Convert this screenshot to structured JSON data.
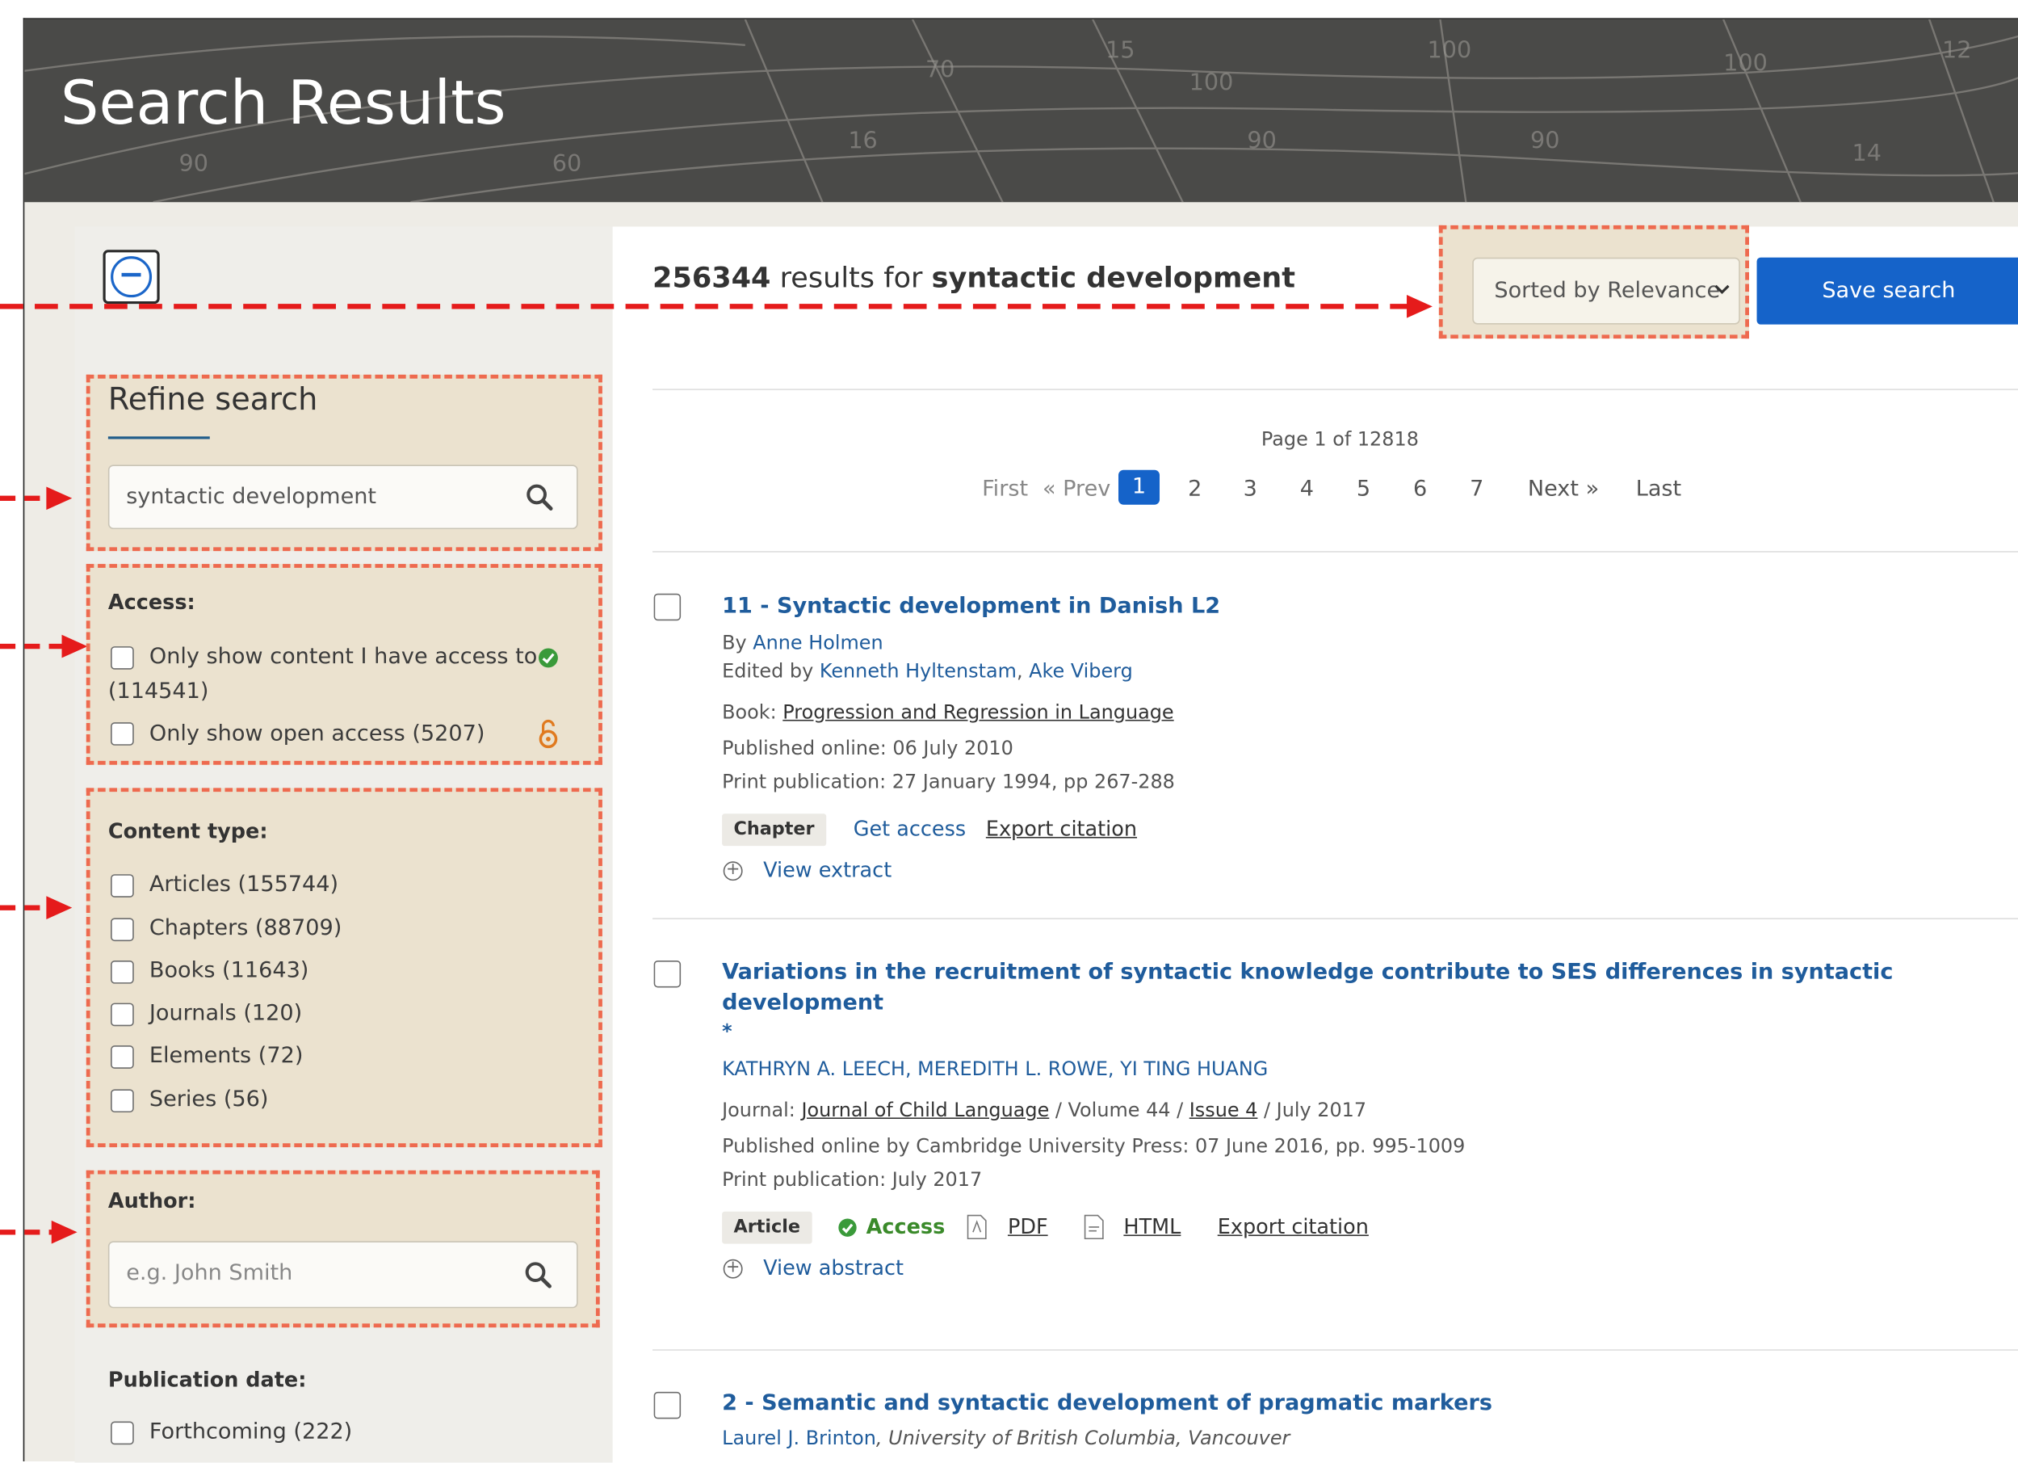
{
  "header": {
    "title": "Search Results"
  },
  "sidebar": {
    "collapse_icon": "minus-circle-icon",
    "refine": {
      "title": "Refine search",
      "query": "syntactic development"
    },
    "access": {
      "title": "Access:",
      "options": [
        {
          "label": "Only show content I have access to",
          "count": "(114541)",
          "icon": "check-circle-icon",
          "icon_color": "#3a9a3a"
        },
        {
          "label": "Only show open access (5207)",
          "icon": "open-lock-icon",
          "icon_color": "#e07a1f"
        }
      ]
    },
    "content_type": {
      "title": "Content type:",
      "options": [
        "Articles (155744)",
        "Chapters (88709)",
        "Books (11643)",
        "Journals (120)",
        "Elements (72)",
        "Series (56)"
      ]
    },
    "author": {
      "title": "Author:",
      "placeholder": "e.g. John Smith"
    },
    "publication_date": {
      "title": "Publication date:",
      "options": [
        "Forthcoming (222)"
      ]
    }
  },
  "results_header": {
    "count": "256344",
    "results_for": " results for ",
    "query": "syntactic development",
    "sort_label": "Sorted by Relevance",
    "save_label": "Save search"
  },
  "pagination": {
    "info": "Page 1 of 12818",
    "first": "First",
    "prev": "« Prev",
    "current": "1",
    "pages": [
      "2",
      "3",
      "4",
      "5",
      "6",
      "7"
    ],
    "next": "Next »",
    "last": "Last"
  },
  "results": [
    {
      "title": "11 - Syntactic development in Danish L2",
      "by_prefix": "By ",
      "author": "Anne Holmen",
      "edited_prefix": "Edited by ",
      "editor1": "Kenneth Hyltenstam",
      "editor_sep": ", ",
      "editor2": "Ake Viberg",
      "source_prefix": "Book: ",
      "source": "Progression and Regression in Language",
      "published_online": "Published online: 06 July 2010",
      "print_pub": "Print publication: 27 January 1994, pp 267-288",
      "type": "Chapter",
      "access": "Get access",
      "export": "Export citation",
      "view": "View extract"
    },
    {
      "title_line1": "Variations in the recruitment of syntactic knowledge contribute to SES differences in syntactic",
      "title_line2": "development",
      "star": "*",
      "authors": "KATHRYN A. LEECH, MEREDITH L. ROWE, YI TING HUANG",
      "journal_prefix": "Journal: ",
      "journal": "Journal of Child Language",
      "volume": " / Volume 44 / ",
      "issue": "Issue 4",
      "date": " / July 2017",
      "published_online": "Published online by Cambridge University Press: 07 June 2016, pp. 995-1009",
      "print_pub": "Print publication: July 2017",
      "type": "Article",
      "access": "Access",
      "pdf": "PDF",
      "html": "HTML",
      "export": "Export citation",
      "view": "View abstract"
    },
    {
      "title": "2 - Semantic and syntactic development of pragmatic markers",
      "author": "Laurel J. Brinton",
      "affiliation": ", University of British Columbia, Vancouver"
    }
  ],
  "colors": {
    "link": "#1f5c9c",
    "primary": "#1563c9",
    "highlight_border": "#ee6a4f",
    "highlight_fill": "#ebe2cf",
    "arrow": "#e51b1b"
  }
}
